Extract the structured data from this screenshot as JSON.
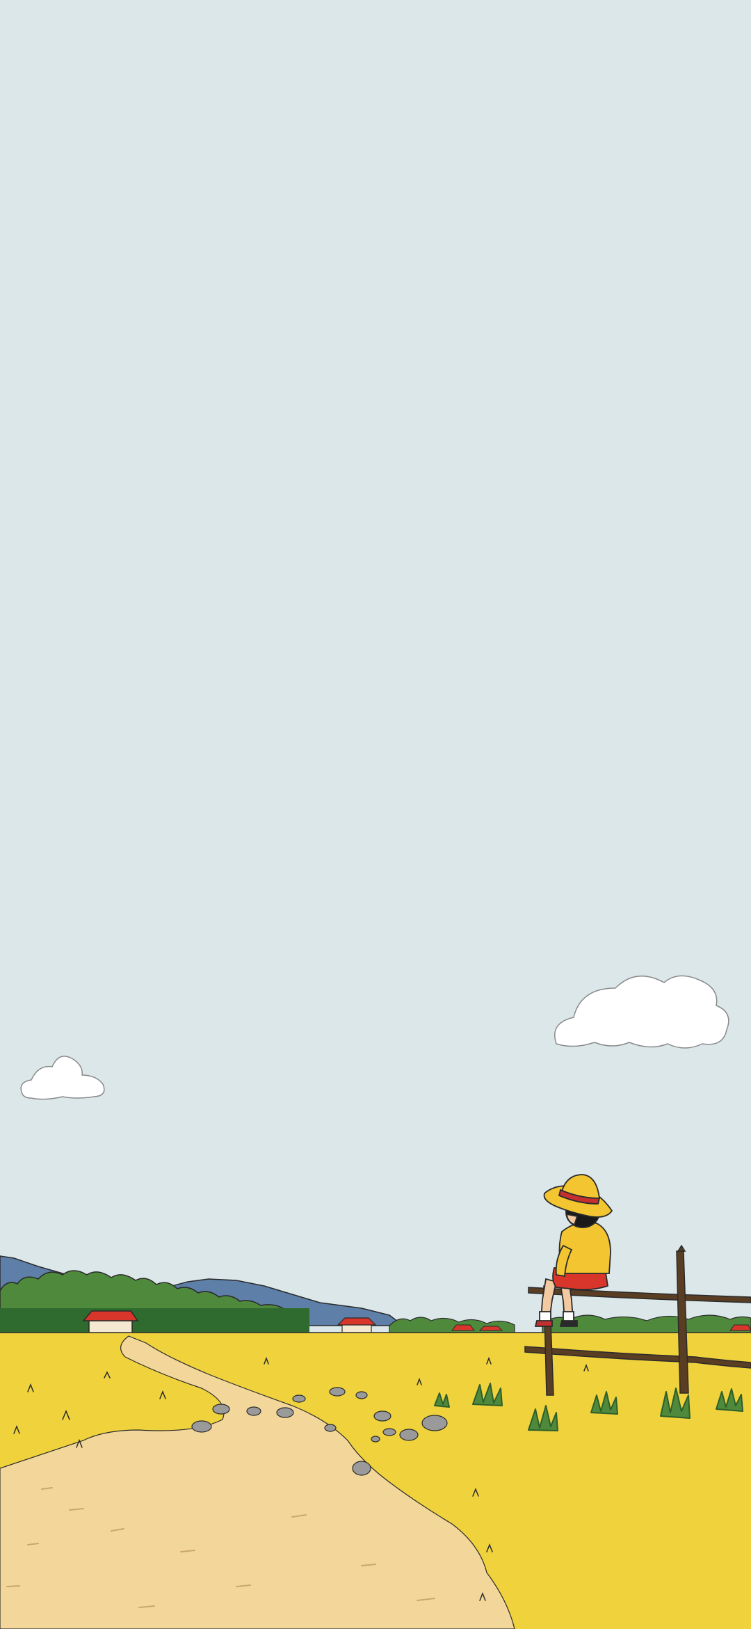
{
  "scene": {
    "description_label": "",
    "colors": {
      "sky": "#DCE7EA",
      "cloud": "#FFFFFF",
      "mountain": "#5E7FA8",
      "trees": "#4F8A3C",
      "trees_dark": "#2F6B2E",
      "field": "#EFD23C",
      "field_dark": "#D9B62A",
      "path": "#F3D79A",
      "roof": "#D9362B",
      "fence": "#5A3E24",
      "hat": "#F2C531",
      "hat_band": "#C43030",
      "shirt": "#F2C531",
      "shorts": "#D9362B",
      "hair": "#1A1A1A",
      "skin": "#F2C9A0",
      "stone": "#9A9A9A",
      "outline": "#2A2A2A"
    },
    "icons": [
      "cloud-icon",
      "mountain-icon",
      "house-icon",
      "tree-icon",
      "fence-icon",
      "child-figure-icon",
      "straw-hat-icon",
      "stone-icon"
    ]
  }
}
